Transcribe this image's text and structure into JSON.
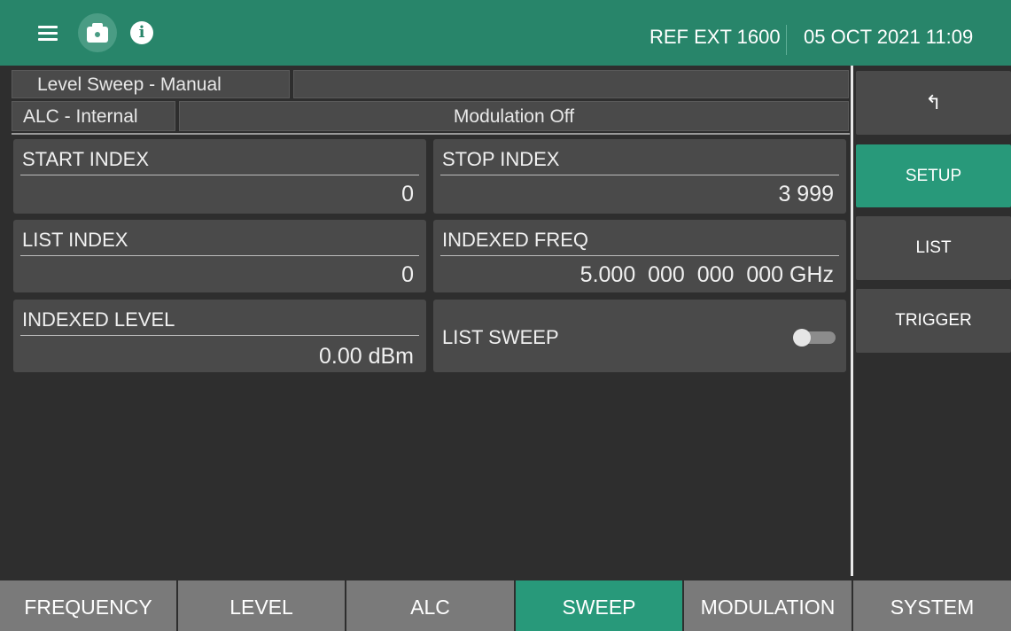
{
  "header": {
    "ref": "REF EXT 1600",
    "datetime": "05 OCT 2021 11:09"
  },
  "status": {
    "sweep_mode": "Level Sweep - Manual",
    "sweep_extra": "",
    "alc": "ALC - Internal",
    "modulation": "Modulation Off"
  },
  "params": {
    "start_index": {
      "label": "START INDEX",
      "value": "0"
    },
    "stop_index": {
      "label": "STOP INDEX",
      "value": "3 999"
    },
    "list_index": {
      "label": "LIST INDEX",
      "value": "0"
    },
    "indexed_freq": {
      "label": "INDEXED FREQ",
      "value": "5.000  000  000  000 GHz"
    },
    "indexed_level": {
      "label": "INDEXED LEVEL",
      "value": "0.00 dBm"
    },
    "list_sweep": {
      "label": "LIST SWEEP",
      "state": "off"
    }
  },
  "side_menu": {
    "back": "↰",
    "setup": "SETUP",
    "list": "LIST",
    "trigger": "TRIGGER"
  },
  "tabs": [
    "FREQUENCY",
    "LEVEL",
    "ALC",
    "SWEEP",
    "MODULATION",
    "SYSTEM"
  ],
  "active_tab": "SWEEP",
  "colors": {
    "header": "#28856a",
    "accent": "#28997a",
    "panel": "#4a4a4a",
    "background": "#2e2e2e",
    "tab": "#7a7a7a"
  },
  "icons": {
    "menu": "menu-icon",
    "camera": "camera-icon",
    "info": "info-icon",
    "back": "back-arrow-icon"
  }
}
